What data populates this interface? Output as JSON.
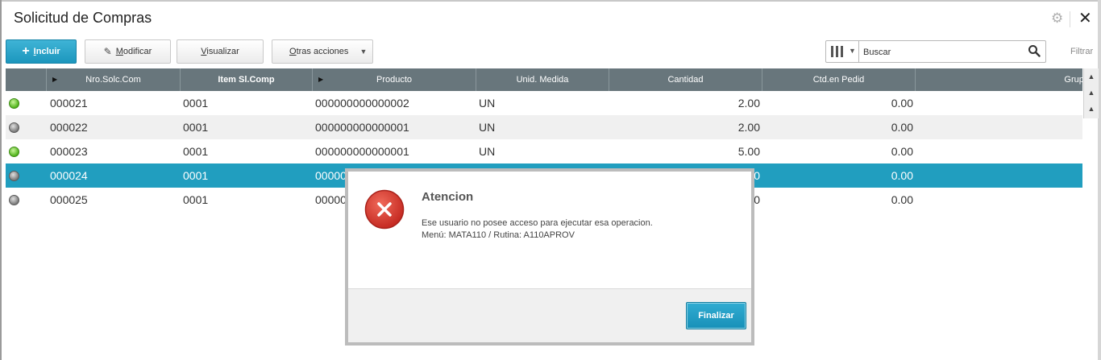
{
  "window": {
    "title": "Solicitud de Compras"
  },
  "toolbar": {
    "include": {
      "accel": "I",
      "rest": "ncluir"
    },
    "modify": {
      "accel": "M",
      "rest": "odificar"
    },
    "view": {
      "accel": "V",
      "rest": "isualizar"
    },
    "other": {
      "accel": "O",
      "rest": "tras acciones"
    }
  },
  "search": {
    "placeholder": "Buscar"
  },
  "filter_label": "Filtrar",
  "grid": {
    "columns": [
      "Nro.Solc.Com",
      "Item Sl.Comp",
      "Producto",
      "Unid. Medida",
      "Cantidad",
      "Ctd.en Pedid",
      "Grupo"
    ],
    "rows": [
      {
        "status": "green",
        "nro": "000021",
        "item": "0001",
        "producto": "000000000000002",
        "unidad": "UN",
        "cantidad": "2.00",
        "pedido": "0.00"
      },
      {
        "status": "gray",
        "nro": "000022",
        "item": "0001",
        "producto": "000000000000001",
        "unidad": "UN",
        "cantidad": "2.00",
        "pedido": "0.00"
      },
      {
        "status": "green",
        "nro": "000023",
        "item": "0001",
        "producto": "000000000000001",
        "unidad": "UN",
        "cantidad": "5.00",
        "pedido": "0.00"
      },
      {
        "status": "gray",
        "nro": "000024",
        "item": "0001",
        "producto": "00000",
        "unidad": "",
        "cantidad": "0",
        "pedido": "0.00",
        "selected": true
      },
      {
        "status": "gray",
        "nro": "000025",
        "item": "0001",
        "producto": "00000",
        "unidad": "",
        "cantidad": "0",
        "pedido": "0.00"
      }
    ]
  },
  "dialog": {
    "title": "Atencion",
    "message_line1": "Ese usuario no posee acceso para ejecutar esa operacion.",
    "message_line2": "Menú: MATA110 / Rutina: A110APROV",
    "button": "Finalizar"
  },
  "colors": {
    "accent": "#219ebf",
    "header": "#68767c",
    "ok_status": "#52b41c",
    "inactive_status": "#7a7a7a",
    "error": "#d9342b"
  },
  "icons": [
    "gear-icon",
    "close-icon",
    "plus-icon",
    "pencil-icon",
    "columns-icon",
    "search-icon",
    "error-icon"
  ]
}
